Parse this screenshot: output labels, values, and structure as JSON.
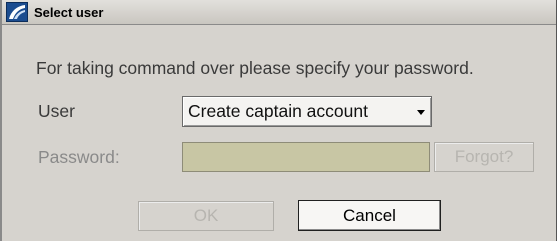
{
  "window": {
    "title": "Select user",
    "icon": "ship-app-icon"
  },
  "message": "For taking command over please specify your password.",
  "user": {
    "label": "User",
    "selected": "Create captain account"
  },
  "password": {
    "label": "Password:",
    "value": "",
    "forgot_label": "Forgot?"
  },
  "buttons": {
    "ok_label": "OK",
    "cancel_label": "Cancel"
  },
  "colors": {
    "dialog_bg": "#d6d3ce",
    "password_field_bg": "#c8c6a4",
    "icon_bg": "#1b4c8f"
  }
}
